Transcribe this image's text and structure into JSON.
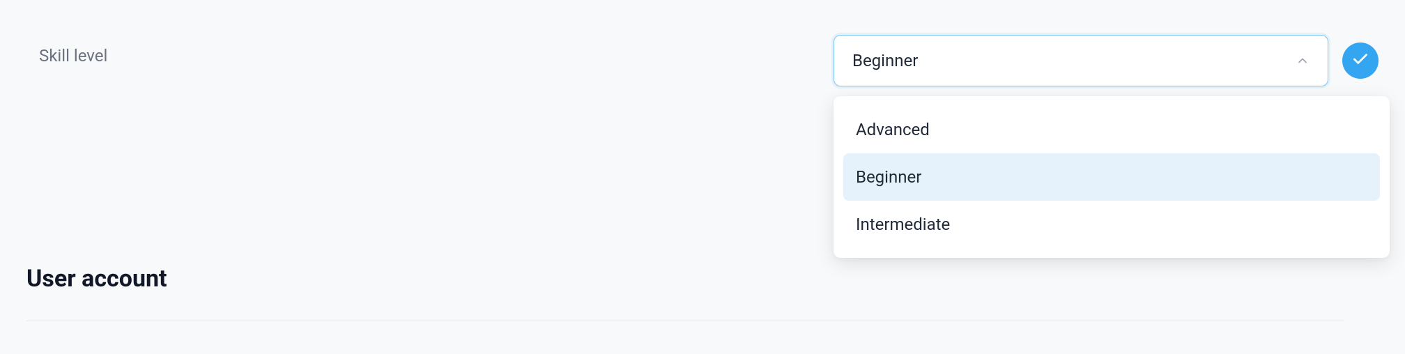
{
  "field": {
    "label": "Skill level",
    "selected_value": "Beginner",
    "options": [
      {
        "label": "Advanced",
        "selected": false
      },
      {
        "label": "Beginner",
        "selected": true
      },
      {
        "label": "Intermediate",
        "selected": false
      }
    ]
  },
  "section": {
    "heading": "User account"
  }
}
